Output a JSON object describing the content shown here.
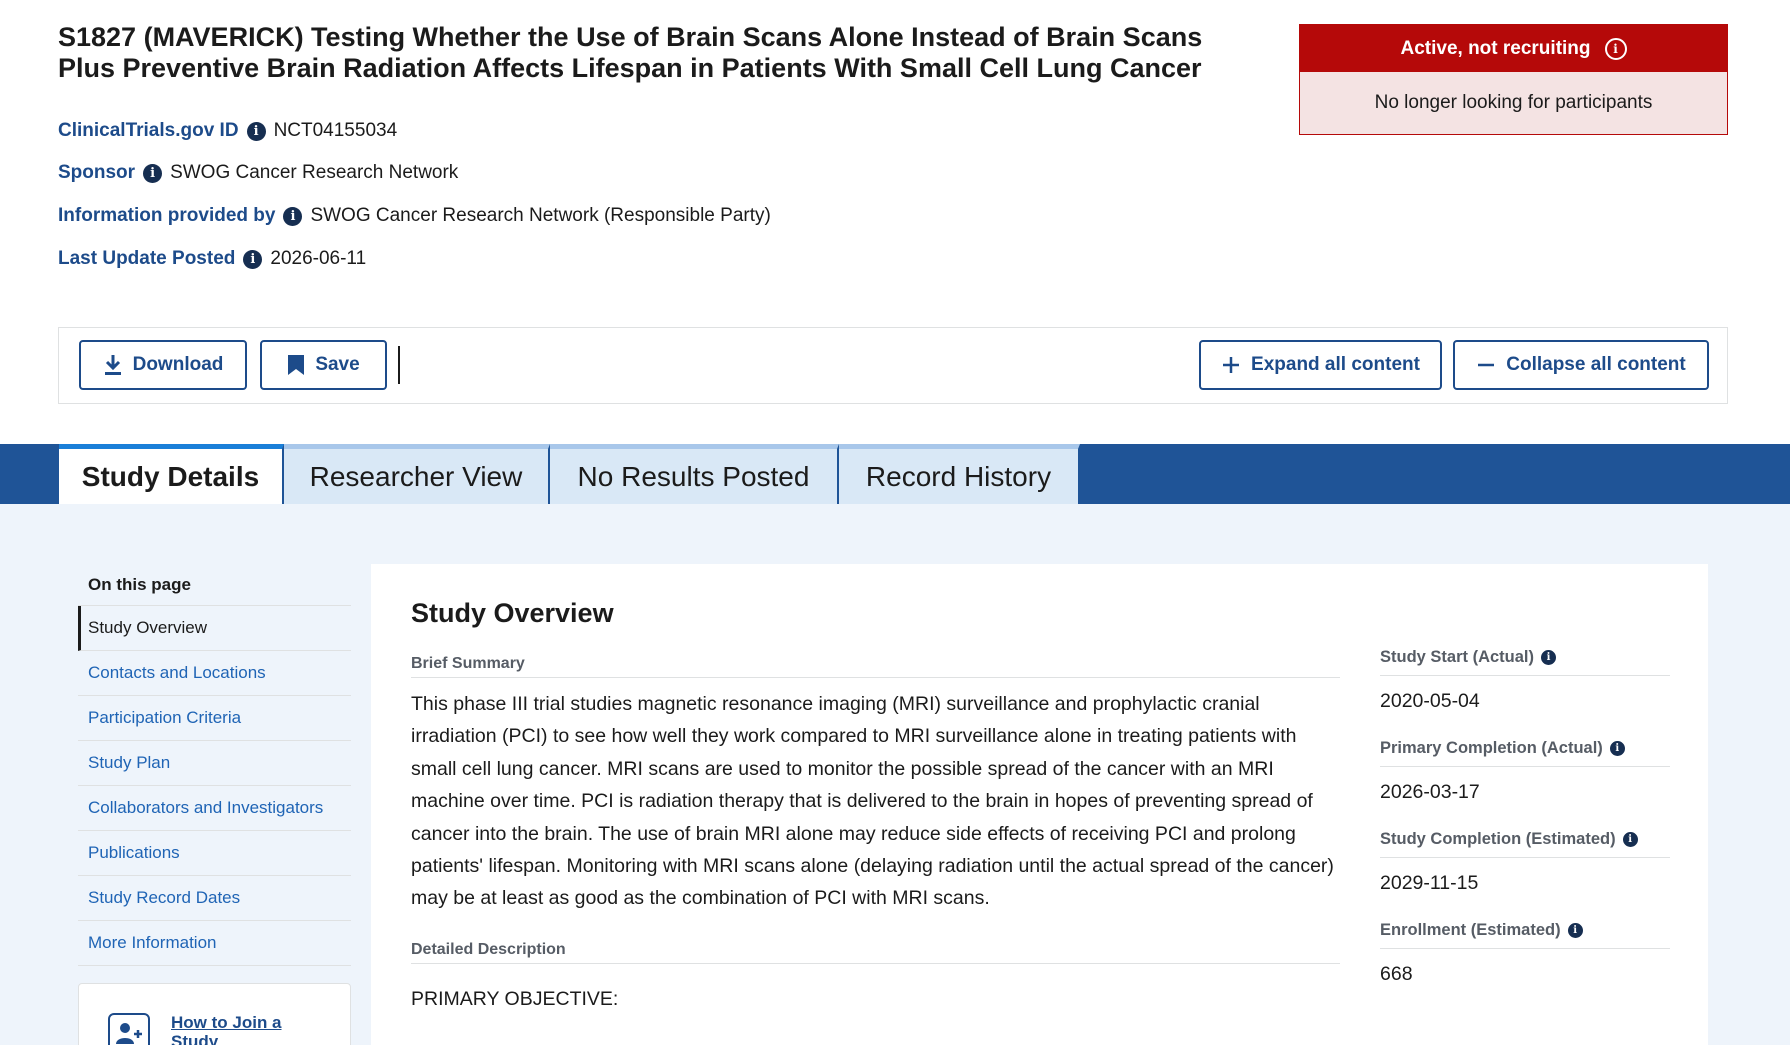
{
  "header": {
    "title": "S1827 (MAVERICK) Testing Whether the Use of Brain Scans Alone Instead of Brain Scans Plus Preventive Brain Radiation Affects Lifespan in Patients With Small Cell Lung Cancer",
    "meta": [
      {
        "label": "ClinicalTrials.gov ID",
        "value": "NCT04155034"
      },
      {
        "label": "Sponsor",
        "value": "SWOG Cancer Research Network"
      },
      {
        "label": "Information provided by",
        "value": "SWOG Cancer Research Network (Responsible Party)"
      },
      {
        "label": "Last Update Posted",
        "value": "2026-06-11"
      }
    ],
    "status": {
      "label": "Active, not recruiting",
      "description": "No longer looking for participants",
      "color": "#b50909"
    }
  },
  "toolbar": {
    "download_label": "Download",
    "save_label": "Save",
    "expand_label": "Expand all content",
    "collapse_label": "Collapse all content"
  },
  "tabs": [
    {
      "label": "Study Details",
      "active": true
    },
    {
      "label": "Researcher View",
      "active": false
    },
    {
      "label": "No Results Posted",
      "active": false
    },
    {
      "label": "Record History",
      "active": false
    }
  ],
  "sidenav": {
    "heading": "On this page",
    "items": [
      {
        "label": "Study Overview",
        "current": true
      },
      {
        "label": "Contacts and Locations"
      },
      {
        "label": "Participation Criteria"
      },
      {
        "label": "Study Plan"
      },
      {
        "label": "Collaborators and Investigators"
      },
      {
        "label": "Publications"
      },
      {
        "label": "Study Record Dates"
      },
      {
        "label": "More Information"
      }
    ],
    "join_label": "How to Join a Study"
  },
  "overview": {
    "title": "Study Overview",
    "brief_summary_heading": "Brief Summary",
    "brief_summary": "This phase III trial studies magnetic resonance imaging (MRI) surveillance and prophylactic cranial irradiation (PCI) to see how well they work compared to MRI surveillance alone in treating patients with small cell lung cancer. MRI scans are used to monitor the possible spread of the cancer with an MRI machine over time. PCI is radiation therapy that is delivered to the brain in hopes of preventing spread of cancer into the brain. The use of brain MRI alone may reduce side effects of receiving PCI and prolong patients' lifespan. Monitoring with MRI scans alone (delaying radiation until the actual spread of the cancer) may be at least as good as the combination of PCI with MRI scans.",
    "detailed_description_heading": "Detailed Description",
    "detailed_description_start": "PRIMARY OBJECTIVE:",
    "facts": [
      {
        "label": "Study Start (Actual)",
        "value": "2020-05-04"
      },
      {
        "label": "Primary Completion (Actual)",
        "value": "2026-03-17"
      },
      {
        "label": "Study Completion (Estimated)",
        "value": "2029-11-15"
      },
      {
        "label": "Enrollment (Estimated)",
        "value": "668"
      }
    ]
  },
  "colors": {
    "brand_blue": "#1d4b8a",
    "tab_bar": "#1f5497",
    "link": "#1f64b5"
  }
}
